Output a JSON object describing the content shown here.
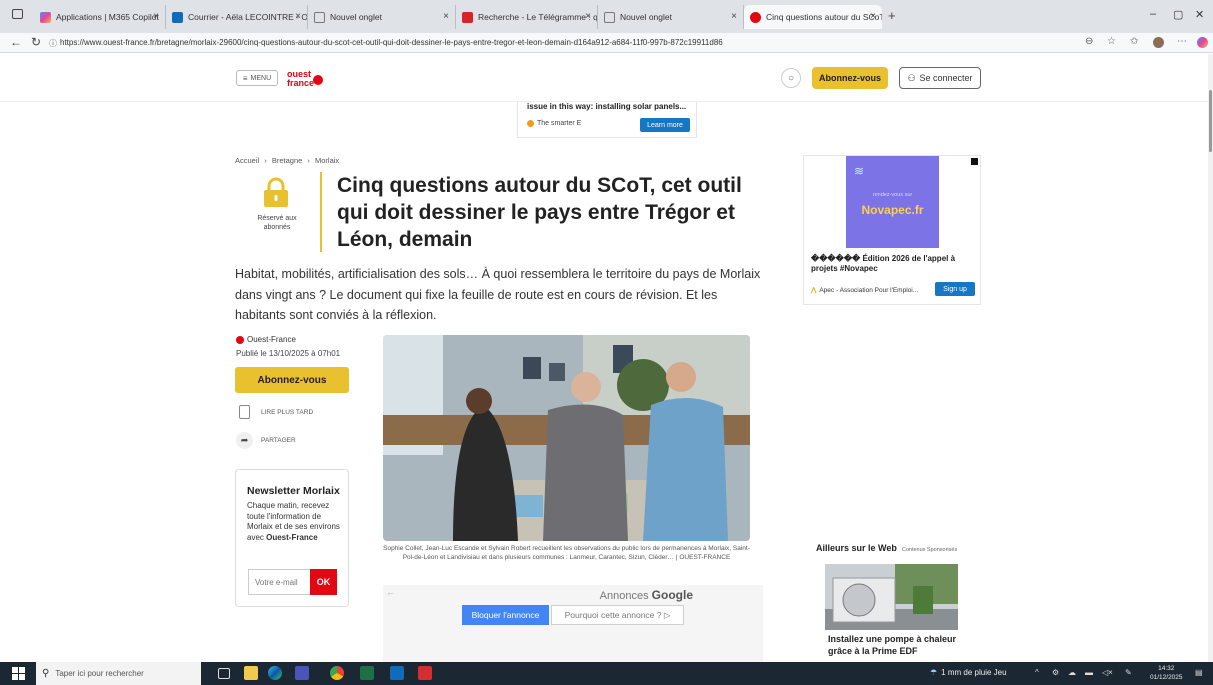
{
  "browser": {
    "tabs": [
      {
        "label": "Applications | M365 Copilot",
        "color": "#e4469a"
      },
      {
        "label": "Courrier - Aëla LECOINTRE - Outl",
        "color": "#0f6cbd"
      },
      {
        "label": "Nouvel onglet",
        "color": "#777777"
      },
      {
        "label": "Recherche - Le Télégramme : quo",
        "color": "#d8232a"
      },
      {
        "label": "Nouvel onglet",
        "color": "#777777"
      },
      {
        "label": "Cinq questions autour du SCoT, c",
        "color": "#e30613"
      }
    ],
    "new_tab": "+",
    "close_glyph": "×",
    "url": "https://www.ouest-france.fr/bretagne/morlaix-29600/cinq-questions-autour-du-scot-cet-outil-qui-doit-dessiner-le-pays-entre-tregor-et-leon-demain-d164a912-a684-11f0-997b-872c19911d86"
  },
  "header": {
    "menu_label": "MENU",
    "logo_text_top": "ouest",
    "logo_text_bottom": "france",
    "subscribe_label": "Abonnez-vous",
    "login_label": "Se connecter"
  },
  "top_ad": {
    "text": "issue in this way: installing solar panels...",
    "brand": "The smarter E",
    "cta": "Learn more"
  },
  "article": {
    "breadcrumb": [
      "Accueil",
      "Bretagne",
      "Morlaix"
    ],
    "breadcrumb_sep": "›",
    "reserve_label": "Réservé aux abonnés",
    "title": "Cinq questions autour du SCoT, cet outil qui doit dessiner le pays entre Trégor et Léon, demain",
    "lead": "Habitat, mobilités, artificialisation des sols… À quoi ressemblera le territoire du pays de Morlaix dans vingt ans ? Le document qui fixe la feuille de route est en cours de révision. Et les habitants sont conviés à la réflexion.",
    "source": "Ouest-France",
    "published": "Publié le 13/10/2025 à 07h01",
    "subscribe_label": "Abonnez-vous",
    "read_later": "LIRE PLUS TARD",
    "share": "PARTAGER",
    "caption": "Sophie Collet, Jean-Luc Escande et Sylvain Robert recueillent les observations du public lors de permanences à Morlaix, Saint-Pol-de-Léon et Landivisiau et dans plusieurs communes : Lanmeur, Carantec, Sizun, Cléder… | OUEST-FRANCE"
  },
  "newsletter": {
    "title": "Newsletter Morlaix",
    "text_before": "Chaque matin, recevez toute l'information de Morlaix et de ses environs avec ",
    "brand": "Ouest-France",
    "email_placeholder": "Votre e-mail",
    "ok_label": "OK"
  },
  "google_ad": {
    "label": "Annonces",
    "label_brand": "Google",
    "block_label": "Bloquer l'annonce",
    "why_label": "Pourquoi cette annonce ? ▷"
  },
  "right_ad": {
    "small_text": "rendez-vous sur",
    "big_text": "Novapec.fr",
    "headline": "������ Édition 2026 de l'appel à projets #Novapec",
    "brand": "Apec - Association Pour l'Emploi...",
    "cta": "Sign up"
  },
  "ailleurs": {
    "title": "Ailleurs sur le Web",
    "sponsor": "Contenus Sponsorisés",
    "item_title": "Installez une pompe à chaleur grâce à la Prime EDF"
  },
  "taskbar": {
    "search_placeholder": "Taper ici pour rechercher",
    "weather": "1 mm de pluie Jeu",
    "time": "14:32",
    "date": "01/12/2025"
  }
}
